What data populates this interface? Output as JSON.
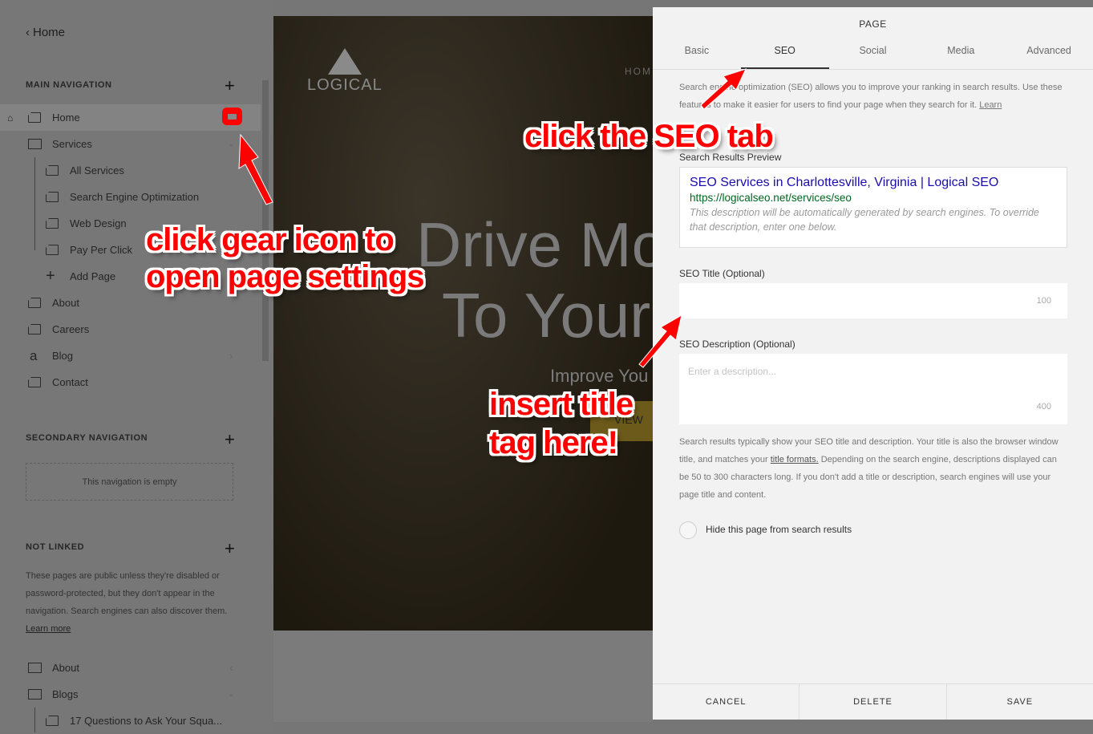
{
  "sidebar": {
    "back_label": "Home",
    "main_nav": {
      "heading": "MAIN NAVIGATION",
      "items": [
        {
          "label": "Home",
          "type": "page",
          "is_homepage": true,
          "active": true
        },
        {
          "label": "Services",
          "type": "folder",
          "expanded": true
        },
        {
          "label": "All Services",
          "type": "page",
          "child": true
        },
        {
          "label": "Search Engine Optimization",
          "type": "page",
          "child": true
        },
        {
          "label": "Web Design",
          "type": "page",
          "child": true
        },
        {
          "label": "Pay Per Click",
          "type": "page",
          "child": true
        },
        {
          "label": "Add Page",
          "type": "add",
          "child": true
        },
        {
          "label": "About",
          "type": "page"
        },
        {
          "label": "Careers",
          "type": "page"
        },
        {
          "label": "Blog",
          "type": "blog"
        },
        {
          "label": "Contact",
          "type": "page"
        }
      ]
    },
    "secondary_nav": {
      "heading": "SECONDARY NAVIGATION",
      "empty_text": "This navigation is empty"
    },
    "not_linked": {
      "heading": "NOT LINKED",
      "description": "These pages are public unless they're disabled or password-protected, but they don't appear in the navigation. Search engines can also discover them.",
      "learn_more": "Learn more",
      "items": [
        {
          "label": "About",
          "type": "folder"
        },
        {
          "label": "Blogs",
          "type": "folder"
        },
        {
          "label": "17 Questions to Ask Your Squa...",
          "type": "page",
          "child": true
        }
      ]
    }
  },
  "preview": {
    "logo": "LOGICAL",
    "nav_partial": "HOM",
    "hero_line1": "Drive Mo",
    "hero_line2": "To Your",
    "subtitle": "Improve You",
    "cta": "VIEW"
  },
  "panel": {
    "title": "PAGE",
    "tabs": [
      {
        "label": "Basic"
      },
      {
        "label": "SEO",
        "active": true
      },
      {
        "label": "Social"
      },
      {
        "label": "Media"
      },
      {
        "label": "Advanced"
      }
    ],
    "intro": "Search engine optimization (SEO) allows you to improve your ranking in search results. Use these features to make it easier for users to find your page when they search for it.",
    "intro_link": "Learn",
    "preview_label": "Search Results Preview",
    "serp": {
      "title": "SEO Services in Charlottesville, Virginia | Logical SEO",
      "url": "https://logicalseo.net/services/seo",
      "description": "This description will be automatically generated by search engines. To override that description, enter one below."
    },
    "seo_title": {
      "label": "SEO Title (Optional)",
      "value": "",
      "limit": "100"
    },
    "seo_description": {
      "label": "SEO Description (Optional)",
      "placeholder": "Enter a description...",
      "limit": "400"
    },
    "help_a": "Search results typically show your SEO title and description. Your title is also the browser window title, and matches your",
    "help_link": "title formats.",
    "help_b": "Depending on the search engine, descriptions displayed can be 50 to 300 characters long. If you don't add a title or description, search engines will use your page title and content.",
    "hide_label": "Hide this page from search results",
    "hide_checked": false,
    "footer": {
      "cancel": "CANCEL",
      "delete": "DELETE",
      "save": "SAVE"
    }
  },
  "annotations": {
    "gear": "click gear icon to\nopen page settings",
    "gear_line1": "click gear icon to",
    "gear_line2": "open page settings",
    "seo_tab": "click the SEO tab",
    "title_line1": "insert title",
    "title_line2": "tag here!",
    "color": "#ff0000"
  }
}
